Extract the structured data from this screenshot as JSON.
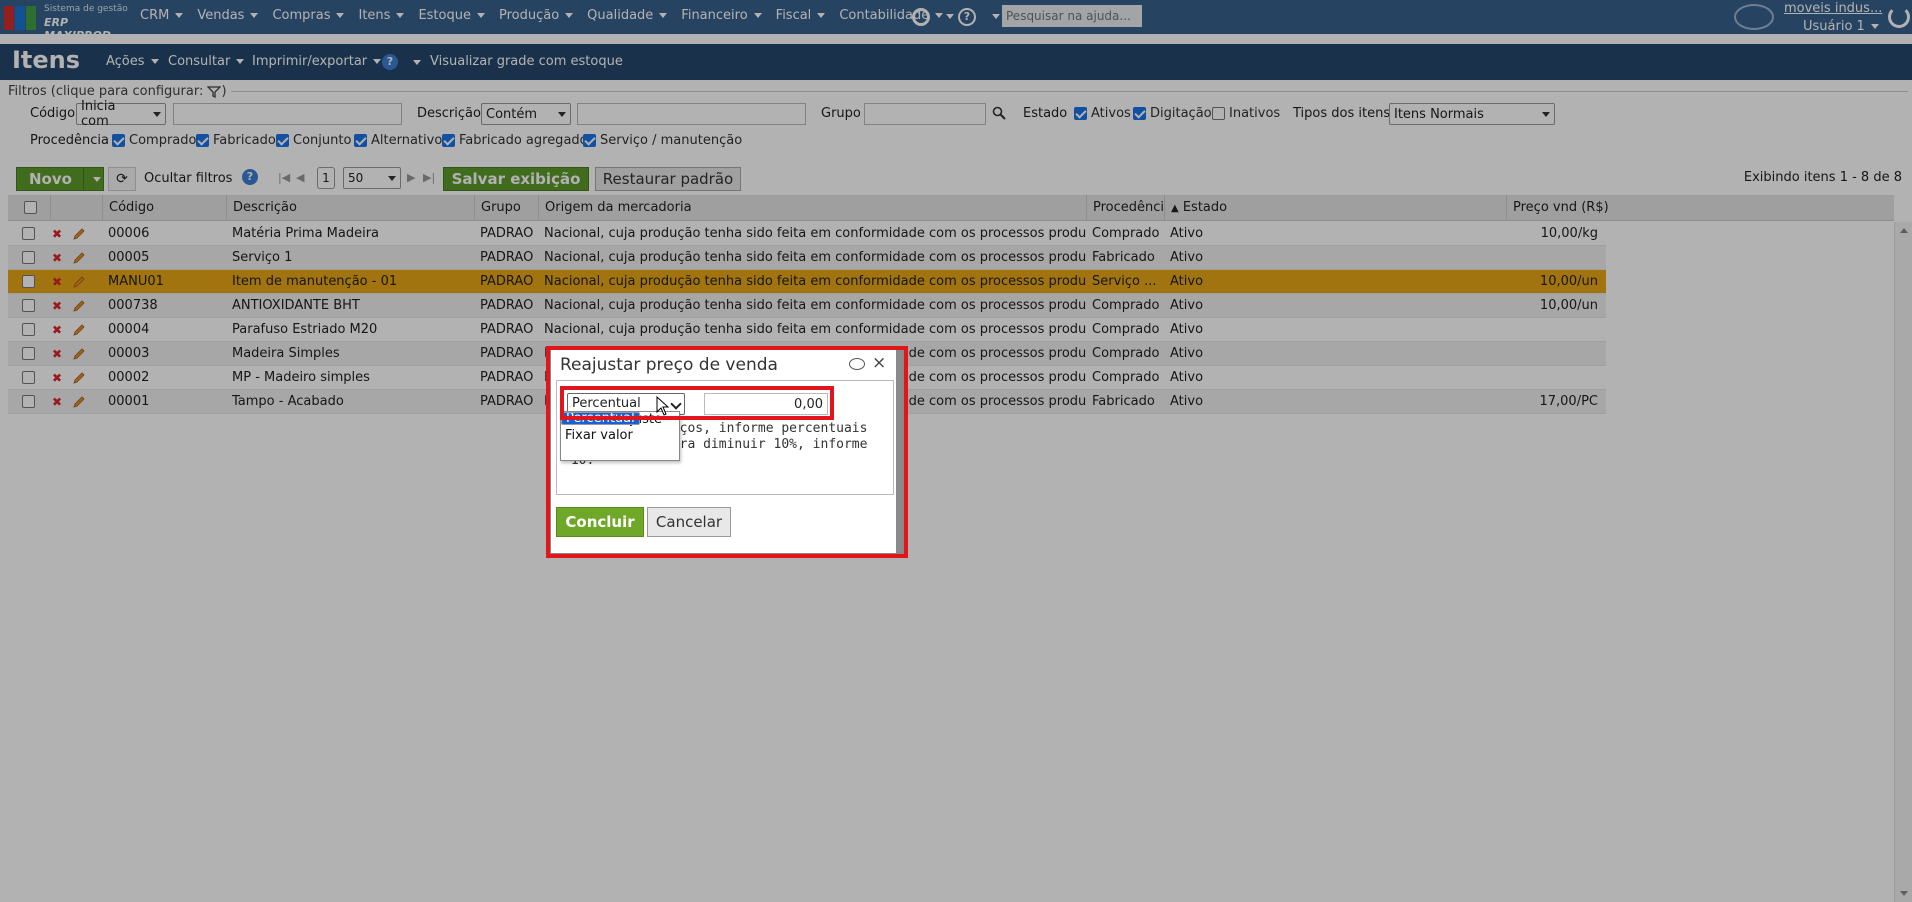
{
  "app": {
    "logo_line1": "Sistema de gestão",
    "logo_line2": "ERP MAXIPROD",
    "logo_colors": [
      "#d32f2f",
      "#1976d2",
      "#43a047"
    ]
  },
  "topnav": {
    "items": [
      "CRM",
      "Vendas",
      "Compras",
      "Itens",
      "Estoque",
      "Produção",
      "Qualidade",
      "Financeiro",
      "Fiscal",
      "Contabilidade"
    ],
    "help_symbol": "?",
    "search_placeholder": "Pesquisar na ajuda...",
    "company": "moveis indus...",
    "user": "Usuário 1"
  },
  "page": {
    "title": "Itens",
    "menu": [
      "Ações",
      "Consultar",
      "Imprimir/exportar",
      "Visualizar grade com estoque"
    ]
  },
  "filters": {
    "legend": "Filtros (clique para configurar:",
    "legend_close": ")",
    "codigo_label": "Código",
    "codigo_op": "Inicia com",
    "descricao_label": "Descrição",
    "descricao_op": "Contém",
    "grupo_label": "Grupo",
    "estado_label": "Estado",
    "estado_opts": [
      {
        "label": "Ativos",
        "checked": true
      },
      {
        "label": "Digitação",
        "checked": true
      },
      {
        "label": "Inativos",
        "checked": false
      }
    ],
    "tipos_label": "Tipos dos itens",
    "tipos_value": "Itens Normais",
    "procedencia_label": "Procedência",
    "procedencia_opts": [
      {
        "label": "Comprado",
        "checked": true
      },
      {
        "label": "Fabricado",
        "checked": true
      },
      {
        "label": "Conjunto",
        "checked": true
      },
      {
        "label": "Alternativo",
        "checked": true
      },
      {
        "label": "Fabricado agregado",
        "checked": true
      },
      {
        "label": "Serviço / manutenção",
        "checked": true
      }
    ]
  },
  "toolbar": {
    "novo": "Novo",
    "ocultar": "Ocultar filtros",
    "page": "1",
    "per_page": "50",
    "salvar": "Salvar exibição",
    "restaurar": "Restaurar padrão",
    "exibindo": "Exibindo itens 1 - 8 de 8"
  },
  "grid": {
    "headers": [
      "Código",
      "Descrição",
      "Grupo",
      "Origem da mercadoria",
      "Procedência",
      "Estado",
      "Preço vnd (R$)"
    ],
    "sort_marker": "▲",
    "rows": [
      {
        "codigo": "00006",
        "descricao": "Matéria Prima Madeira",
        "grupo": "PADRAO",
        "origem": "Nacional, cuja produção tenha sido feita em conformidade com os processos produti...",
        "procedencia": "Comprado",
        "estado": "Ativo",
        "preco": "10,00/kg"
      },
      {
        "codigo": "00005",
        "descricao": "Serviço 1",
        "grupo": "PADRAO",
        "origem": "Nacional, cuja produção tenha sido feita em conformidade com os processos produti...",
        "procedencia": "Fabricado",
        "estado": "Ativo",
        "preco": ""
      },
      {
        "codigo": "MANU01",
        "descricao": "Item de manutenção - 01",
        "grupo": "PADRAO",
        "origem": "Nacional, cuja produção tenha sido feita em conformidade com os processos produti...",
        "procedencia": "Serviço ...",
        "estado": "Ativo",
        "preco": "10,00/un"
      },
      {
        "codigo": "000738",
        "descricao": "ANTIOXIDANTE BHT",
        "grupo": "PADRAO",
        "origem": "Nacional, cuja produção tenha sido feita em conformidade com os processos produti...",
        "procedencia": "Comprado",
        "estado": "Ativo",
        "preco": "10,00/un"
      },
      {
        "codigo": "00004",
        "descricao": "Parafuso Estriado M20",
        "grupo": "PADRAO",
        "origem": "Nacional, cuja produção tenha sido feita em conformidade com os processos produti...",
        "procedencia": "Comprado",
        "estado": "Ativo",
        "preco": ""
      },
      {
        "codigo": "00003",
        "descricao": "Madeira Simples",
        "grupo": "PADRAO",
        "origem": "Nacional, cuja produção tenha sido feita em conformidade com os processos produti...",
        "procedencia": "Comprado",
        "estado": "Ativo",
        "preco": ""
      },
      {
        "codigo": "00002",
        "descricao": "MP - Madeiro simples",
        "grupo": "PADRAO",
        "origem": "Nacional, cuja produção tenha sido feita em conformidade com os processos produti...",
        "procedencia": "Comprado",
        "estado": "Ativo",
        "preco": ""
      },
      {
        "codigo": "00001",
        "descricao": "Tampo - Acabado",
        "grupo": "PADRAO",
        "origem": "Nacional, cuja produção tenha sido feita em conformidade com os processos produti...",
        "procedencia": "Fabricado",
        "estado": "Ativo",
        "preco": "17,00/PC"
      }
    ]
  },
  "dialog": {
    "title": "Reajustar preço de venda",
    "close": "×",
    "mode_selected": "Percentual",
    "value": "0,00",
    "help_line1": "r os preços, informe percentuais",
    "help_line2": "mplo: para diminuir 10%, informe",
    "help_line3": "-10.",
    "options": [
      "Percentual",
      "Valor de ajuste",
      "Fixar valor"
    ],
    "concluir": "Concluir",
    "cancelar": "Cancelar"
  }
}
